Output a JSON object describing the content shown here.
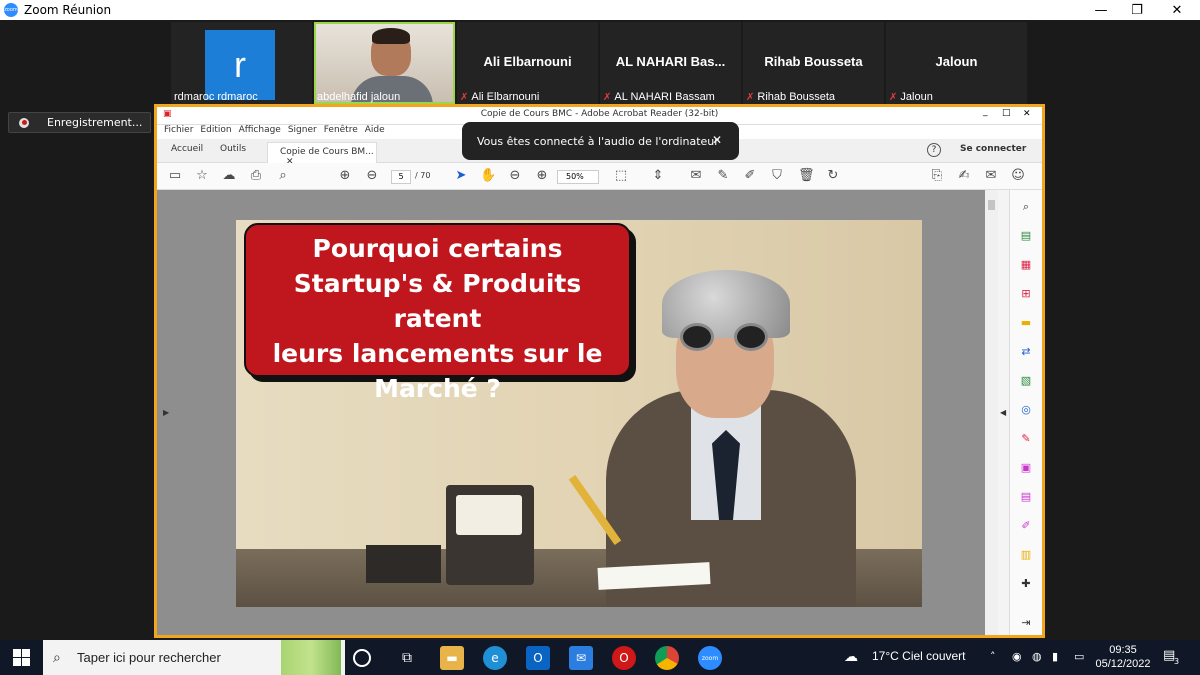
{
  "zoom": {
    "window_title": "Zoom Réunion",
    "logo_text": "zoom",
    "minimize": "—",
    "restore": "❐",
    "close": "✕"
  },
  "participants": [
    {
      "name": "rdmaroc rdmaroc",
      "avatar_letter": "r",
      "muted": false
    },
    {
      "name": "abdelhafid jaloun",
      "video": true,
      "muted": false
    },
    {
      "name": "Ali Elbarnouni",
      "display": "Ali Elbarnouni",
      "muted": true
    },
    {
      "name": "AL NAHARI Bassam",
      "display": "AL NAHARI Bas...",
      "muted": true
    },
    {
      "name": "Rihab Bousseta",
      "display": "Rihab Bousseta",
      "muted": true
    },
    {
      "name": "Jaloun",
      "display": "Jaloun",
      "muted": true
    }
  ],
  "recording": {
    "label": "Enregistrement..."
  },
  "toast": {
    "message": "Vous êtes connecté à l'audio de l'ordinateur",
    "close": "✕"
  },
  "acrobat": {
    "title": "Copie de Cours BMC  - Adobe Acrobat Reader (32-bit)",
    "menu": [
      "Fichier",
      "Edition",
      "Affichage",
      "Signer",
      "Fenêtre",
      "Aide"
    ],
    "tabs": {
      "home": "Accueil",
      "tools": "Outils",
      "doc": "Copie de Cours BM...",
      "doc_close": "✕"
    },
    "help": "?",
    "signin": "Se connecter",
    "page_current": "5",
    "page_total": "/ 70",
    "zoom": "50%",
    "win_min": "_",
    "win_max": "□",
    "win_close": "✕"
  },
  "slide": {
    "callout": "Pourquoi certains\nStartup's & Produits ratent\nleurs lancements sur le\nMarché ?"
  },
  "taskbar": {
    "search_placeholder": "Taper ici pour rechercher",
    "weather": "17°C  Ciel couvert",
    "time": "09:35",
    "date": "05/12/2022",
    "notif_count": "3"
  },
  "colors": {
    "acrobat_frame": "#f2a51f",
    "callout_red": "#c0161e",
    "zoom_blue": "#2d8cff",
    "mute_red": "#e23b3b"
  }
}
